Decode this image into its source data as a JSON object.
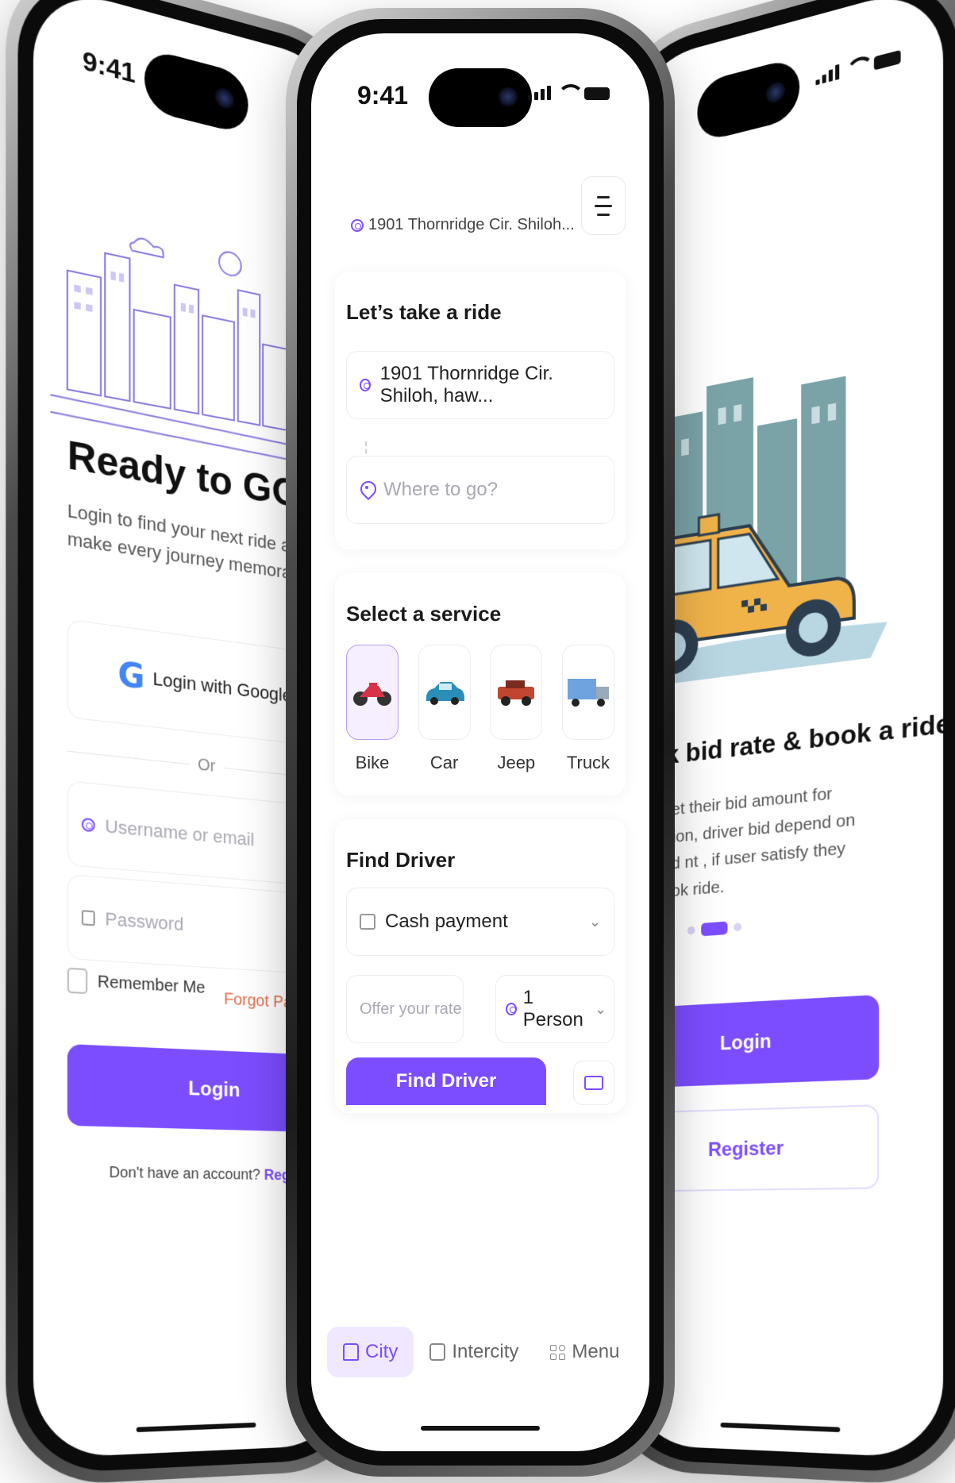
{
  "status": {
    "time": "9:41"
  },
  "left": {
    "title": "Ready to GO?",
    "subtitle": "Login to find your next ride and make every journey memorable",
    "google_label": "Login with Google",
    "or_label": "Or",
    "username_placeholder": "Username or email",
    "password_placeholder": "Password",
    "remember_label": "Remember Me",
    "forgot_label": "Forgot Pa",
    "login_label": "Login",
    "no_account": "Don't have an account?",
    "register_link": "Register"
  },
  "center": {
    "location_chip": "1901 Thornridge Cir. Shiloh...",
    "ride_title": "Let’s take a ride",
    "pickup_value": "1901 Thornridge Cir. Shiloh, haw...",
    "destination_placeholder": "Where to go?",
    "service_title": "Select a service",
    "services": [
      {
        "label": "Bike",
        "icon": "motorbike-icon",
        "active": true
      },
      {
        "label": "Car",
        "icon": "car-icon",
        "active": false
      },
      {
        "label": "Jeep",
        "icon": "jeep-icon",
        "active": false
      },
      {
        "label": "Truck",
        "icon": "truck-icon",
        "active": false
      }
    ],
    "find_title": "Find Driver",
    "payment_value": "Cash payment",
    "offer_placeholder": "Offer your rate",
    "person_value": "1 Person",
    "find_button": "Find Driver",
    "tabs": [
      {
        "label": "City",
        "icon": "home-icon",
        "active": true
      },
      {
        "label": "Intercity",
        "icon": "intercity-icon",
        "active": false
      },
      {
        "label": "Menu",
        "icon": "grid-icon",
        "active": false
      }
    ]
  },
  "right": {
    "title": "heck bid rate & book a ride",
    "subtitle": "r can set their bid amount for their ation, driver bid depend on user bid nt , if user satisfy they can book ride.",
    "login_label": "Login",
    "register_label": "Register"
  },
  "colors": {
    "accent": "#7c4dff",
    "accent_light": "#efe8ff",
    "forgot": "#e36e4c"
  }
}
